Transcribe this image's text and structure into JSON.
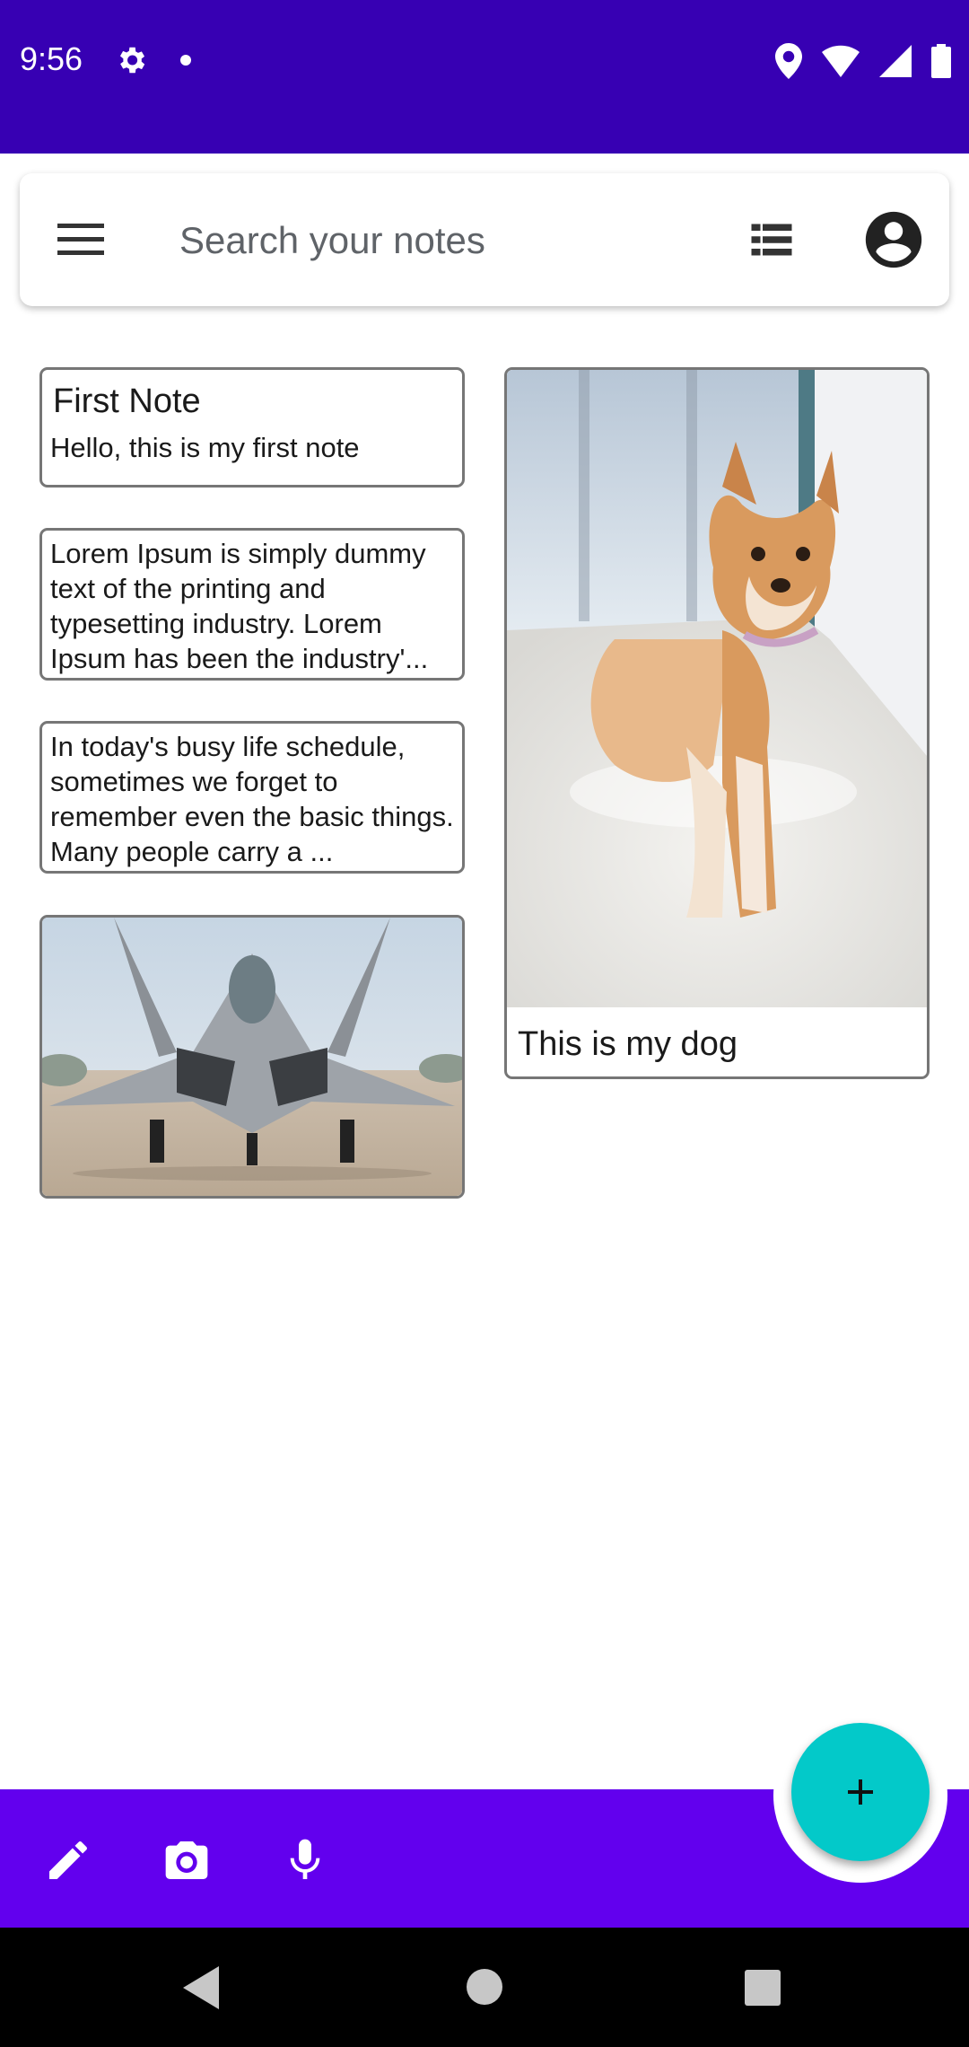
{
  "status_bar": {
    "time": "9:56",
    "icons": [
      "settings-icon",
      "notification-dot-icon",
      "location-icon",
      "wifi-icon",
      "signal-icon",
      "battery-icon"
    ]
  },
  "search": {
    "placeholder": "Search your notes",
    "value": ""
  },
  "toolbar_icons": [
    "menu-icon",
    "list-view-icon",
    "account-icon"
  ],
  "notes": [
    {
      "title": "First Note",
      "body": "Hello, this is my first note"
    },
    {
      "body": "Lorem Ipsum is simply dummy text of the printing and typesetting industry. Lorem Ipsum has been the industry'..."
    },
    {
      "body": "In today's busy life schedule, sometimes we forget to remember even the basic things. Many people carry a ..."
    },
    {
      "image": "fighter-jet-photo"
    },
    {
      "image": "shiba-dog-photo",
      "caption": "This is my dog"
    }
  ],
  "bottom_bar": {
    "actions": [
      "pencil-icon",
      "camera-icon",
      "microphone-icon"
    ],
    "fab": "plus-icon"
  },
  "nav_bar": [
    "back-icon",
    "home-icon",
    "recents-icon"
  ],
  "colors": {
    "status_bar": "#3700b3",
    "bottom_bar": "#6200ee",
    "fab": "#03c9c9",
    "note_border": "#767676"
  }
}
